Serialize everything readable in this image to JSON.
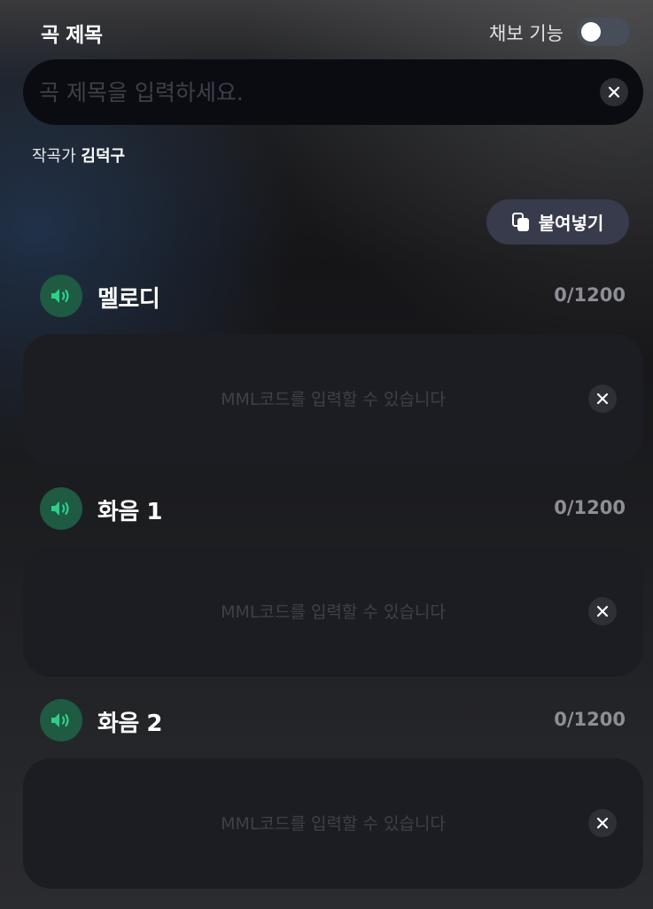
{
  "header": {
    "title_label": "곡 제목",
    "copy_toggle_label": "채보 기능",
    "copy_toggle_on": false
  },
  "title_input": {
    "placeholder": "곡 제목을 입력하세요.",
    "value": ""
  },
  "composer": {
    "prefix": "작곡가",
    "name": "김덕구"
  },
  "paste_button": {
    "label": "붙여넣기",
    "icon": "copy-icon"
  },
  "sections": [
    {
      "name": "멜로디",
      "counter": "0/1200",
      "placeholder": "MML코드를 입력할 수 있습니다",
      "value": "",
      "icon": "speaker-icon"
    },
    {
      "name": "화음 1",
      "counter": "0/1200",
      "placeholder": "MML코드를 입력할 수 있습니다",
      "value": "",
      "icon": "speaker-icon"
    },
    {
      "name": "화음 2",
      "counter": "0/1200",
      "placeholder": "MML코드를 입력할 수 있습니다",
      "value": "",
      "icon": "speaker-icon"
    }
  ],
  "colors": {
    "accent_green": "#2ecf86",
    "speaker_bg": "#1f5a43",
    "input_bg": "#0b0c12",
    "box_bg": "#1c1c23",
    "paste_bg": "#373b4c",
    "toggle_off": "#474d59"
  }
}
